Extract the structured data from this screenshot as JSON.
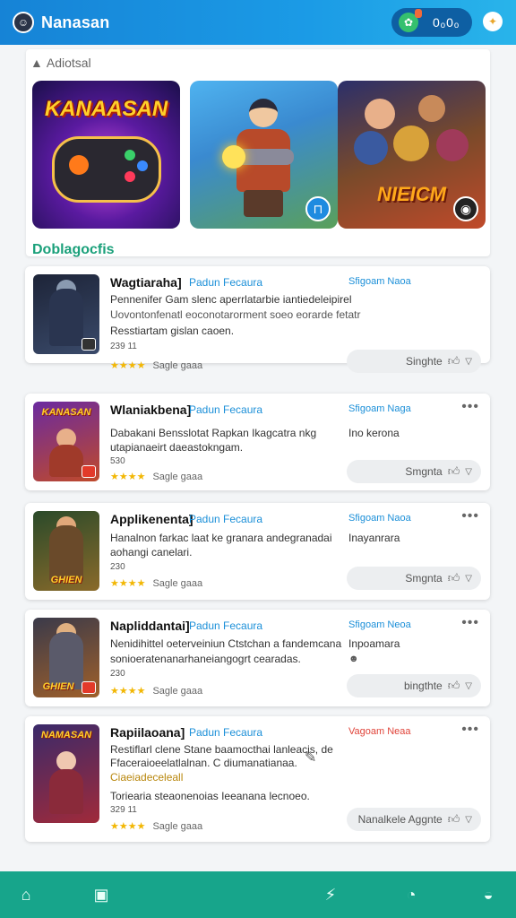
{
  "header": {
    "title": "Nanasan",
    "pill_text": "0ₒ0ₒ"
  },
  "featured": {
    "label": "Adiotsal",
    "cards": [
      {
        "title": "KANAASAN"
      },
      {
        "title": ""
      },
      {
        "title": "NIEICM"
      }
    ]
  },
  "section": {
    "title": "Doblagocfis"
  },
  "items": [
    {
      "title": "Wagtiaraha]",
      "tag": "Padun Fecaura",
      "right": "Sfigoam Naoa",
      "desc1": "Pennenifer Gam slenc aperrlatarbie iantiedeleipirel",
      "desc2": "Uovontonfenatl eoconotarorment soeo eorarde fetatr",
      "desc3": "Resstiartam gislan caoen.",
      "meta": "239 11",
      "rating_label": "Sagle gaaa",
      "button": "Singhte"
    },
    {
      "title": "Wlaniakbena]",
      "tag": "Padun Fecaura",
      "right": "Sfigoam Naga",
      "desc1": "Dabakani Bensslotat Rapkan Ikagcatra nkg",
      "desc2": "utapianaeirt daeastokngam.",
      "right_desc": "Ino kerona",
      "meta": "530",
      "rating_label": "Sagle gaaa",
      "button": "Smgnta"
    },
    {
      "title": "Applikenenta]",
      "tag": "Padun Fecaura",
      "right": "Sfigoam Naoa",
      "desc1": "Hanalnon farkac laat ke granara andegranadai",
      "desc2": "aohangi canelari.",
      "right_desc": "Inayanrara",
      "meta": "230",
      "rating_label": "Sagle gaaa",
      "button": "Smgnta"
    },
    {
      "title": "Napliddantai]",
      "tag": "Padun Fecaura",
      "right": "Sfigoam Neoa",
      "desc1": "Nenidihittel oeterveiniun Ctstchan a fandemcana",
      "desc2": "sonioeratenanarhaneiangogrt cearadas.",
      "right_desc": "Inpoamara",
      "meta": "230",
      "rating_label": "Sagle gaaa",
      "button": "bingthte"
    },
    {
      "title": "Rapiilaoana]",
      "tag": "Padun Fecaura",
      "right": "Vagoam Neaa",
      "desc1": "Restiflarl clene Stane baamocthai lanleacis, de",
      "desc2": "Ffaceraioeelatlalnan. C diumanatianaa.",
      "desc_highlight": "Ciaeiadeceleall",
      "desc3": "Toriearia steaonenoias Ieeanana lecnoeo.",
      "meta": "329 11",
      "rating_label": "Sagle gaaa",
      "button": "Nanalkele Aggnte"
    }
  ],
  "colors": {
    "header": "#1b9be6",
    "accent_green": "#17a58b",
    "link_blue": "#1b8fd8",
    "star": "#f2b705"
  }
}
